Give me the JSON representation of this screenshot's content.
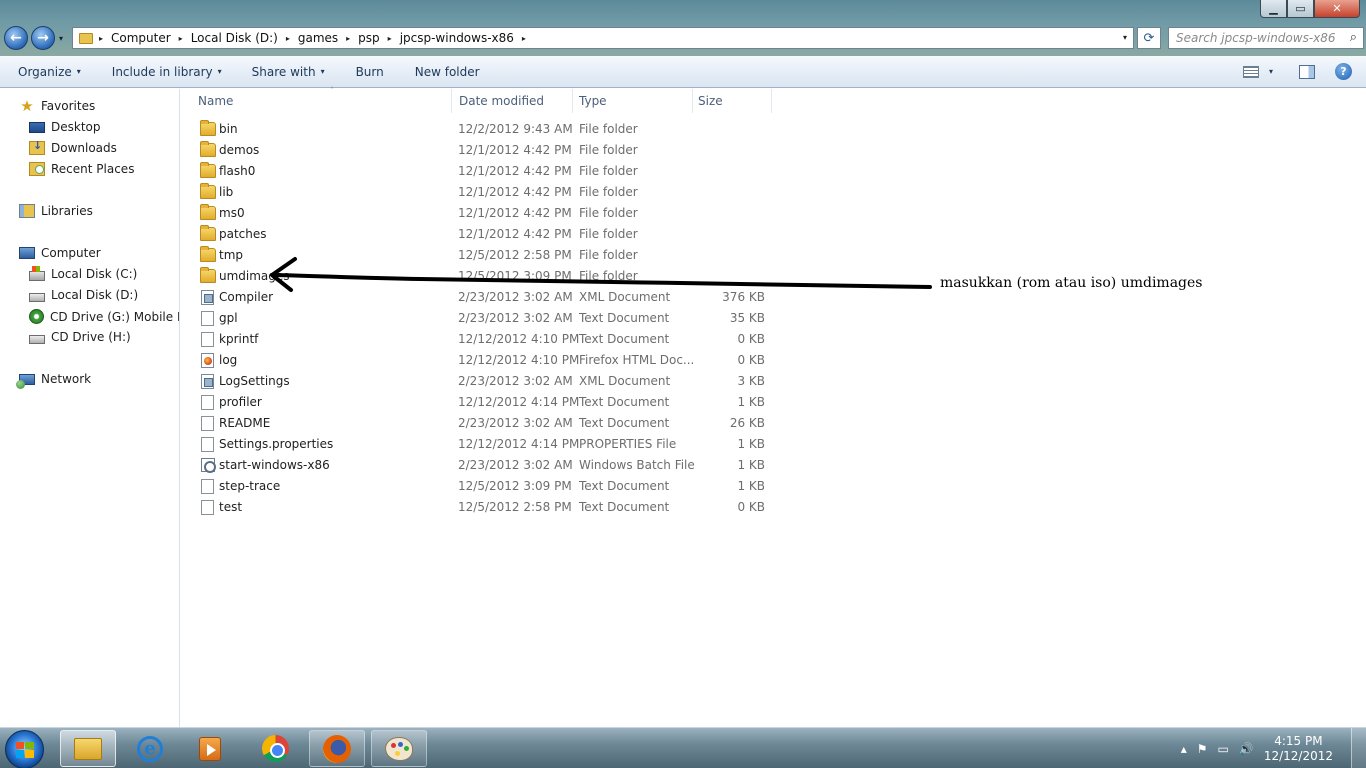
{
  "window": {
    "caption_buttons": {
      "minimize": "▁",
      "maximize": "▭",
      "close": "✕"
    }
  },
  "address_bar": {
    "breadcrumbs": [
      "Computer",
      "Local Disk (D:)",
      "games",
      "psp",
      "jpcsp-windows-x86"
    ],
    "separator": "▸",
    "dropdown": "▾",
    "refresh": "⟳"
  },
  "search": {
    "placeholder": "Search jpcsp-windows-x86",
    "icon": "⌕"
  },
  "nav_buttons": {
    "back": "←",
    "forward": "→",
    "history": "▾"
  },
  "command_bar": {
    "organize": "Organize",
    "include_in_library": "Include in library",
    "share_with": "Share with",
    "burn": "Burn",
    "new_folder": "New folder",
    "caret": "▾",
    "help": "?"
  },
  "nav_pane": {
    "favorites": "Favorites",
    "desktop": "Desktop",
    "downloads": "Downloads",
    "recent_places": "Recent Places",
    "libraries": "Libraries",
    "computer": "Computer",
    "local_disk_c": "Local Disk (C:)",
    "local_disk_d": "Local Disk (D:)",
    "cd_drive_g": "CD Drive (G:) Mobile Par",
    "cd_drive_h": "CD Drive (H:)",
    "network": "Network"
  },
  "columns": {
    "name": "Name",
    "date_modified": "Date modified",
    "type": "Type",
    "size": "Size",
    "sort_indicator": "˄"
  },
  "files": [
    {
      "name": "bin",
      "date": "12/2/2012 9:43 AM",
      "type": "File folder",
      "size": "",
      "icon": "folder"
    },
    {
      "name": "demos",
      "date": "12/1/2012 4:42 PM",
      "type": "File folder",
      "size": "",
      "icon": "folder"
    },
    {
      "name": "flash0",
      "date": "12/1/2012 4:42 PM",
      "type": "File folder",
      "size": "",
      "icon": "folder"
    },
    {
      "name": "lib",
      "date": "12/1/2012 4:42 PM",
      "type": "File folder",
      "size": "",
      "icon": "folder"
    },
    {
      "name": "ms0",
      "date": "12/1/2012 4:42 PM",
      "type": "File folder",
      "size": "",
      "icon": "folder"
    },
    {
      "name": "patches",
      "date": "12/1/2012 4:42 PM",
      "type": "File folder",
      "size": "",
      "icon": "folder"
    },
    {
      "name": "tmp",
      "date": "12/5/2012 2:58 PM",
      "type": "File folder",
      "size": "",
      "icon": "folder"
    },
    {
      "name": "umdimages",
      "date": "12/5/2012 3:09 PM",
      "type": "File folder",
      "size": "",
      "icon": "folder"
    },
    {
      "name": "Compiler",
      "date": "2/23/2012 3:02 AM",
      "type": "XML Document",
      "size": "376 KB",
      "icon": "xml"
    },
    {
      "name": "gpl",
      "date": "2/23/2012 3:02 AM",
      "type": "Text Document",
      "size": "35 KB",
      "icon": "doc"
    },
    {
      "name": "kprintf",
      "date": "12/12/2012 4:10 PM",
      "type": "Text Document",
      "size": "0 KB",
      "icon": "doc"
    },
    {
      "name": "log",
      "date": "12/12/2012 4:10 PM",
      "type": "Firefox HTML Doc...",
      "size": "0 KB",
      "icon": "ff"
    },
    {
      "name": "LogSettings",
      "date": "2/23/2012 3:02 AM",
      "type": "XML Document",
      "size": "3 KB",
      "icon": "xml"
    },
    {
      "name": "profiler",
      "date": "12/12/2012 4:14 PM",
      "type": "Text Document",
      "size": "1 KB",
      "icon": "doc"
    },
    {
      "name": "README",
      "date": "2/23/2012 3:02 AM",
      "type": "Text Document",
      "size": "26 KB",
      "icon": "doc"
    },
    {
      "name": "Settings.properties",
      "date": "12/12/2012 4:14 PM",
      "type": "PROPERTIES File",
      "size": "1 KB",
      "icon": "doc"
    },
    {
      "name": "start-windows-x86",
      "date": "2/23/2012 3:02 AM",
      "type": "Windows Batch File",
      "size": "1 KB",
      "icon": "bat"
    },
    {
      "name": "step-trace",
      "date": "12/5/2012 3:09 PM",
      "type": "Text Document",
      "size": "1 KB",
      "icon": "doc"
    },
    {
      "name": "test",
      "date": "12/5/2012 2:58 PM",
      "type": "Text Document",
      "size": "0 KB",
      "icon": "doc"
    }
  ],
  "annotation": {
    "text": "masukkan (rom atau iso) umdimages"
  },
  "taskbar": {
    "clock_time": "4:15 PM",
    "clock_date": "12/12/2012",
    "tray_arrow": "▴",
    "tray_flag": "⚑",
    "tray_network": "▭",
    "tray_volume": "🔊",
    "ie_letter": "e"
  }
}
